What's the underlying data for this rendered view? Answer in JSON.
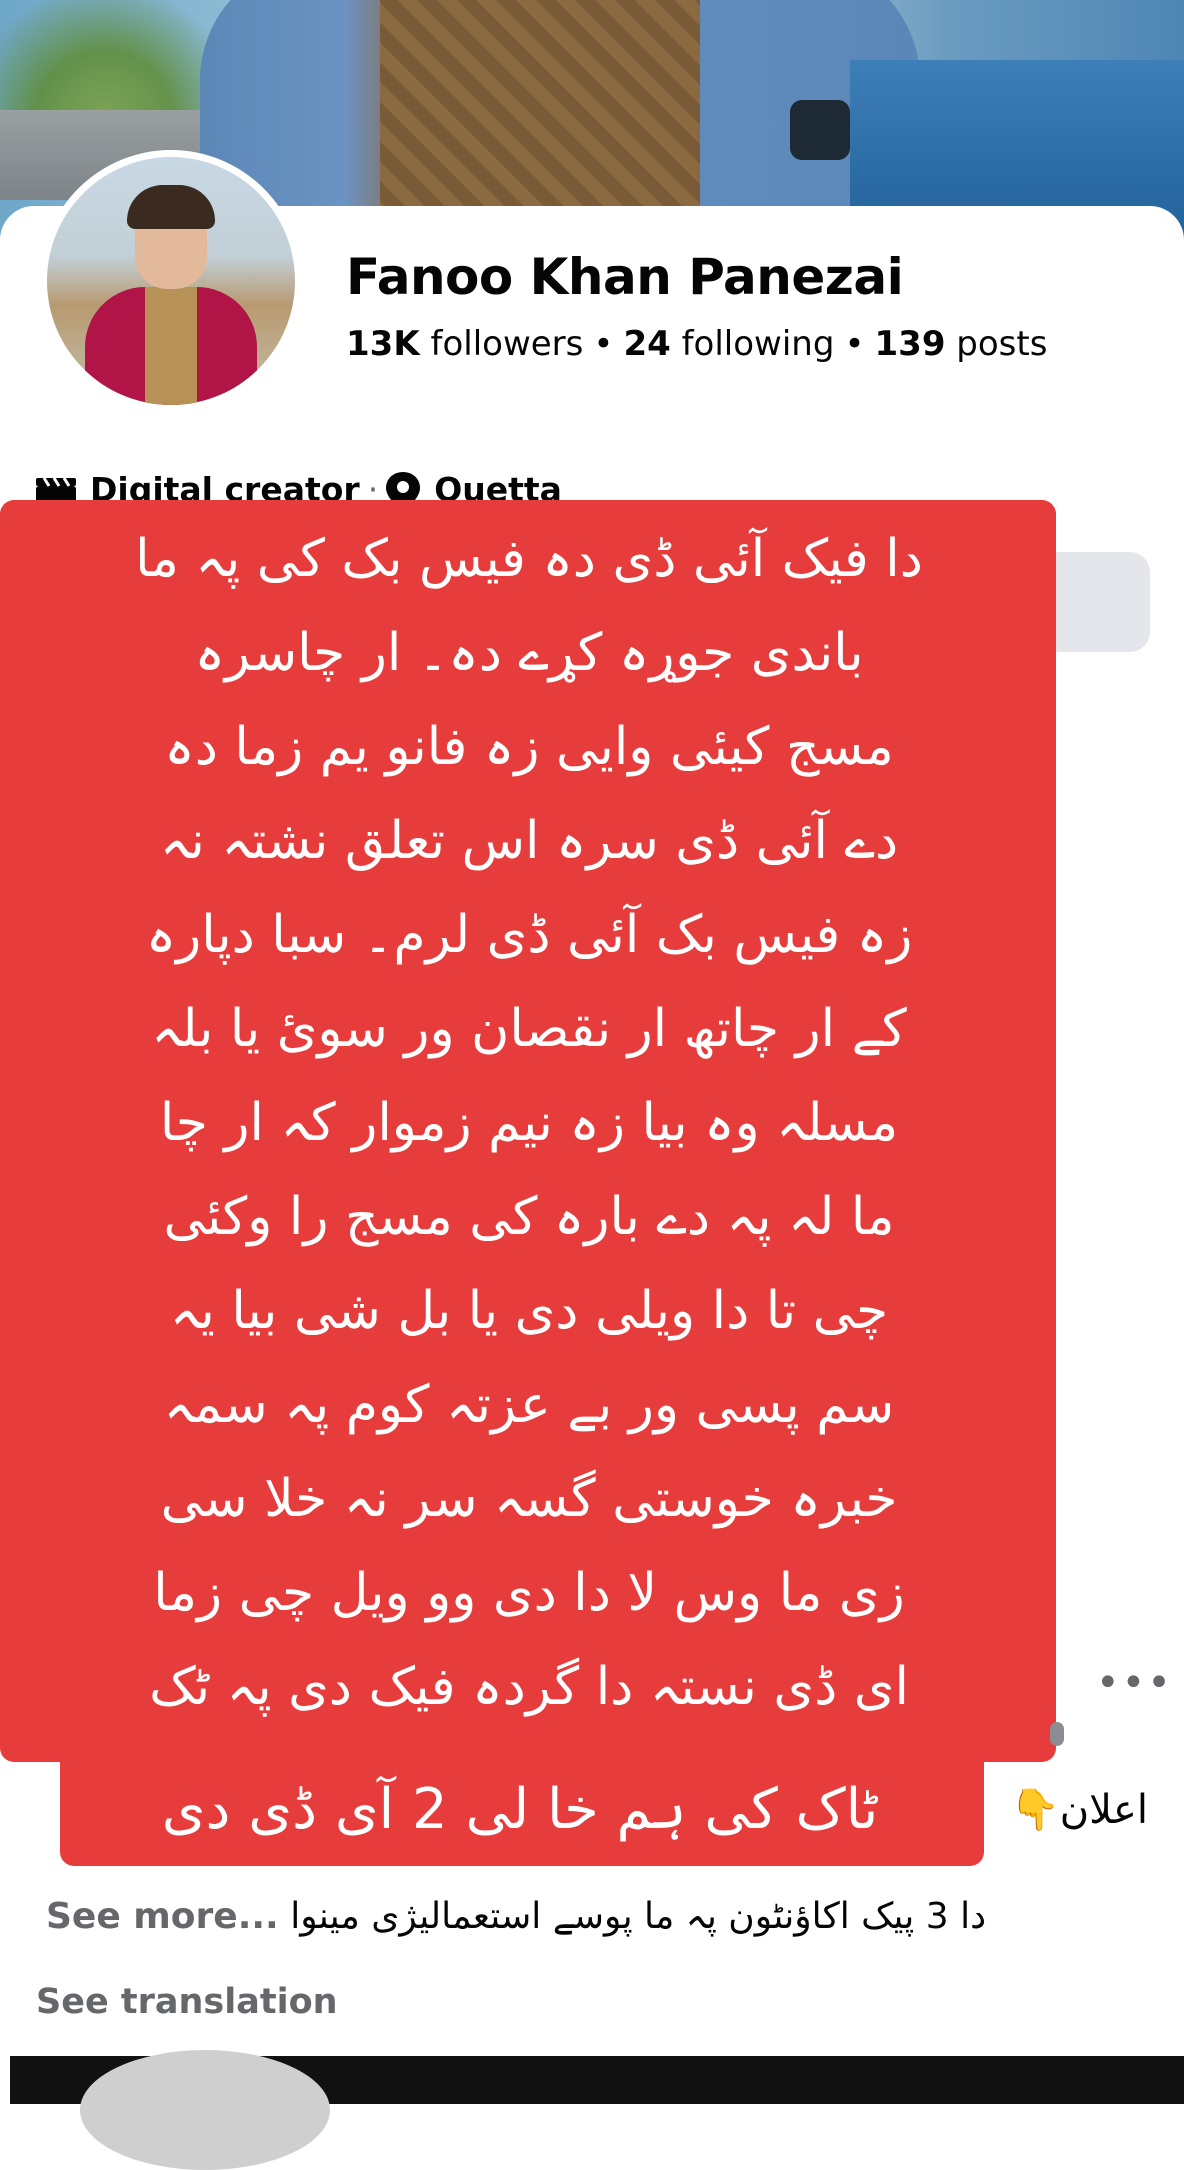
{
  "profile": {
    "name": "Fanoo Khan Panezai",
    "followers_count": "13K",
    "followers_label": "followers",
    "following_count": "24",
    "following_label": "following",
    "posts_count": "139",
    "posts_label": "posts",
    "category": "Digital creator",
    "location": "Quetta",
    "separator": "•"
  },
  "overlay_text": {
    "lines": [
      "دا فیک آئی ڈی دہ فیس بک کی پہ ما",
      "باندی جوړہ کړے دہ۔ ار چاسرہ",
      "مسج کیئی وایی زہ فانو یم زما دہ",
      "دے آئی ڈی سرہ اس تعلق نشتہ نہ",
      "زہ فیس بک آئی ڈی لرم۔ سبا دپارہ",
      "کے ار چاتھ ار نقصان ور سوئ یا بلہ",
      "مسلہ وہ بیا زہ نیم زموار کہ ار چا",
      "ما لہ پہ دے بارہ کی مسج را وکئی",
      "چی تا دا ویلی دی یا بل شی بیا یہ",
      "سم پسی ور بے عزتہ کوم پہ سمہ",
      "خبرہ خوستی گسہ سر نہ خلا سی",
      "زی ما وس لا دا دی وو ویل چی زما",
      "ای ڈی نستہ دا گردہ فیک دی پہ ٹک"
    ],
    "last_line": "ٹاک کی ہم خا لی 2 آی ڈی دی"
  },
  "post": {
    "announcement_label": "اعلان",
    "announcement_emoji": "👇",
    "description": "دا 3 پیک اکاؤنٹون پہ ما پوسے استعمالیژی مینوا",
    "see_more": "See more...",
    "see_translation": "See translation",
    "more_menu": "•••"
  },
  "icons": {
    "category": "clapperboard-icon",
    "location": "map-pin-icon"
  },
  "colors": {
    "overlay_red": "#e63c3c",
    "muted_text": "#65676b"
  }
}
